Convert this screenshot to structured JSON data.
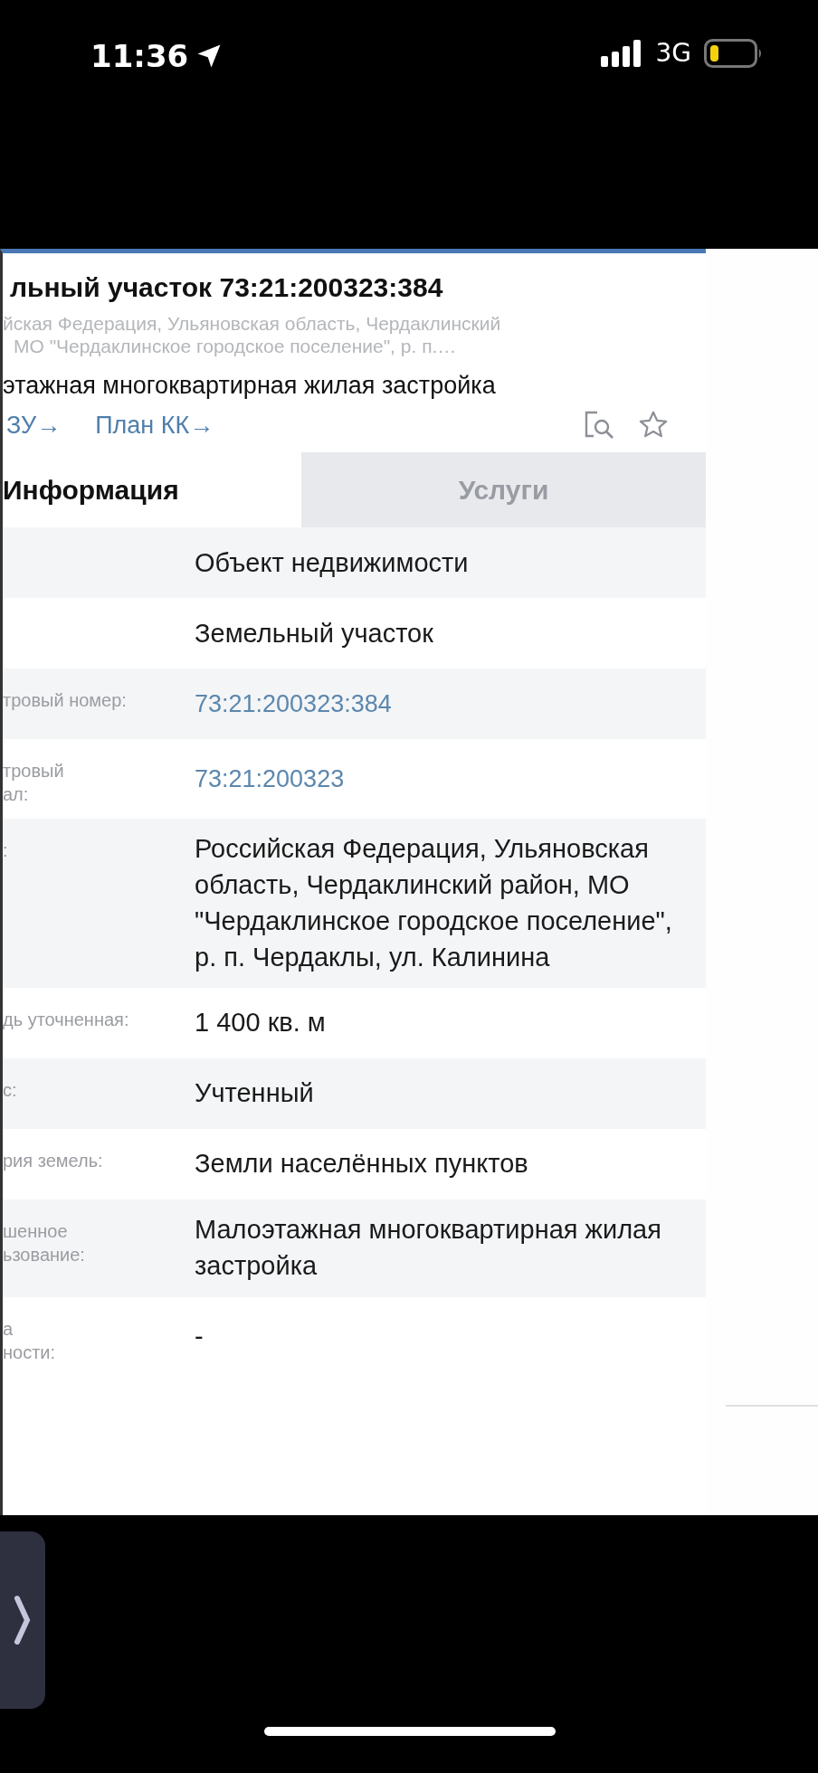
{
  "status_bar": {
    "time": "11:36",
    "network": "3G"
  },
  "header": {
    "title": "льный участок 73:21:200323:384",
    "address_lines": [
      "йская Федерация, Ульяновская область, Чердаклинский",
      "МО \"Чердаклинское городское поселение\", р. п.…"
    ],
    "purpose": "этажная многоквартирная жилая застройка",
    "links": [
      "ЗУ→",
      "План КК→"
    ]
  },
  "tabs": [
    {
      "label": "Информация",
      "selected": true
    },
    {
      "label": "Услуги",
      "selected": false
    }
  ],
  "rows": [
    {
      "label": "",
      "value": "Объект недвижимости",
      "kind": "text"
    },
    {
      "label": "",
      "value": "Земельный участок",
      "kind": "text"
    },
    {
      "label": "тровый номер:",
      "value": "73:21:200323:384",
      "kind": "link"
    },
    {
      "label": "тровый\nал:",
      "value": "73:21:200323",
      "kind": "link"
    },
    {
      "label": ":",
      "value": "Российская Федерация, Ульяновская область, Чердаклинский район, МО \"Чердаклинское городское поселение\", р. п. Чердаклы, ул. Калинина",
      "kind": "text"
    },
    {
      "label": "дь уточненная:",
      "value": "1 400 кв. м",
      "kind": "text"
    },
    {
      "label": "с:",
      "value": "Учтенный",
      "kind": "text"
    },
    {
      "label": "рия земель:",
      "value": "Земли населённых пунктов",
      "kind": "text"
    },
    {
      "label": "шенное\nьзование:",
      "value": "Малоэтажная многоквартирная жилая застройка",
      "kind": "text"
    },
    {
      "label": "а\nности:",
      "value": "-",
      "kind": "text"
    }
  ]
}
